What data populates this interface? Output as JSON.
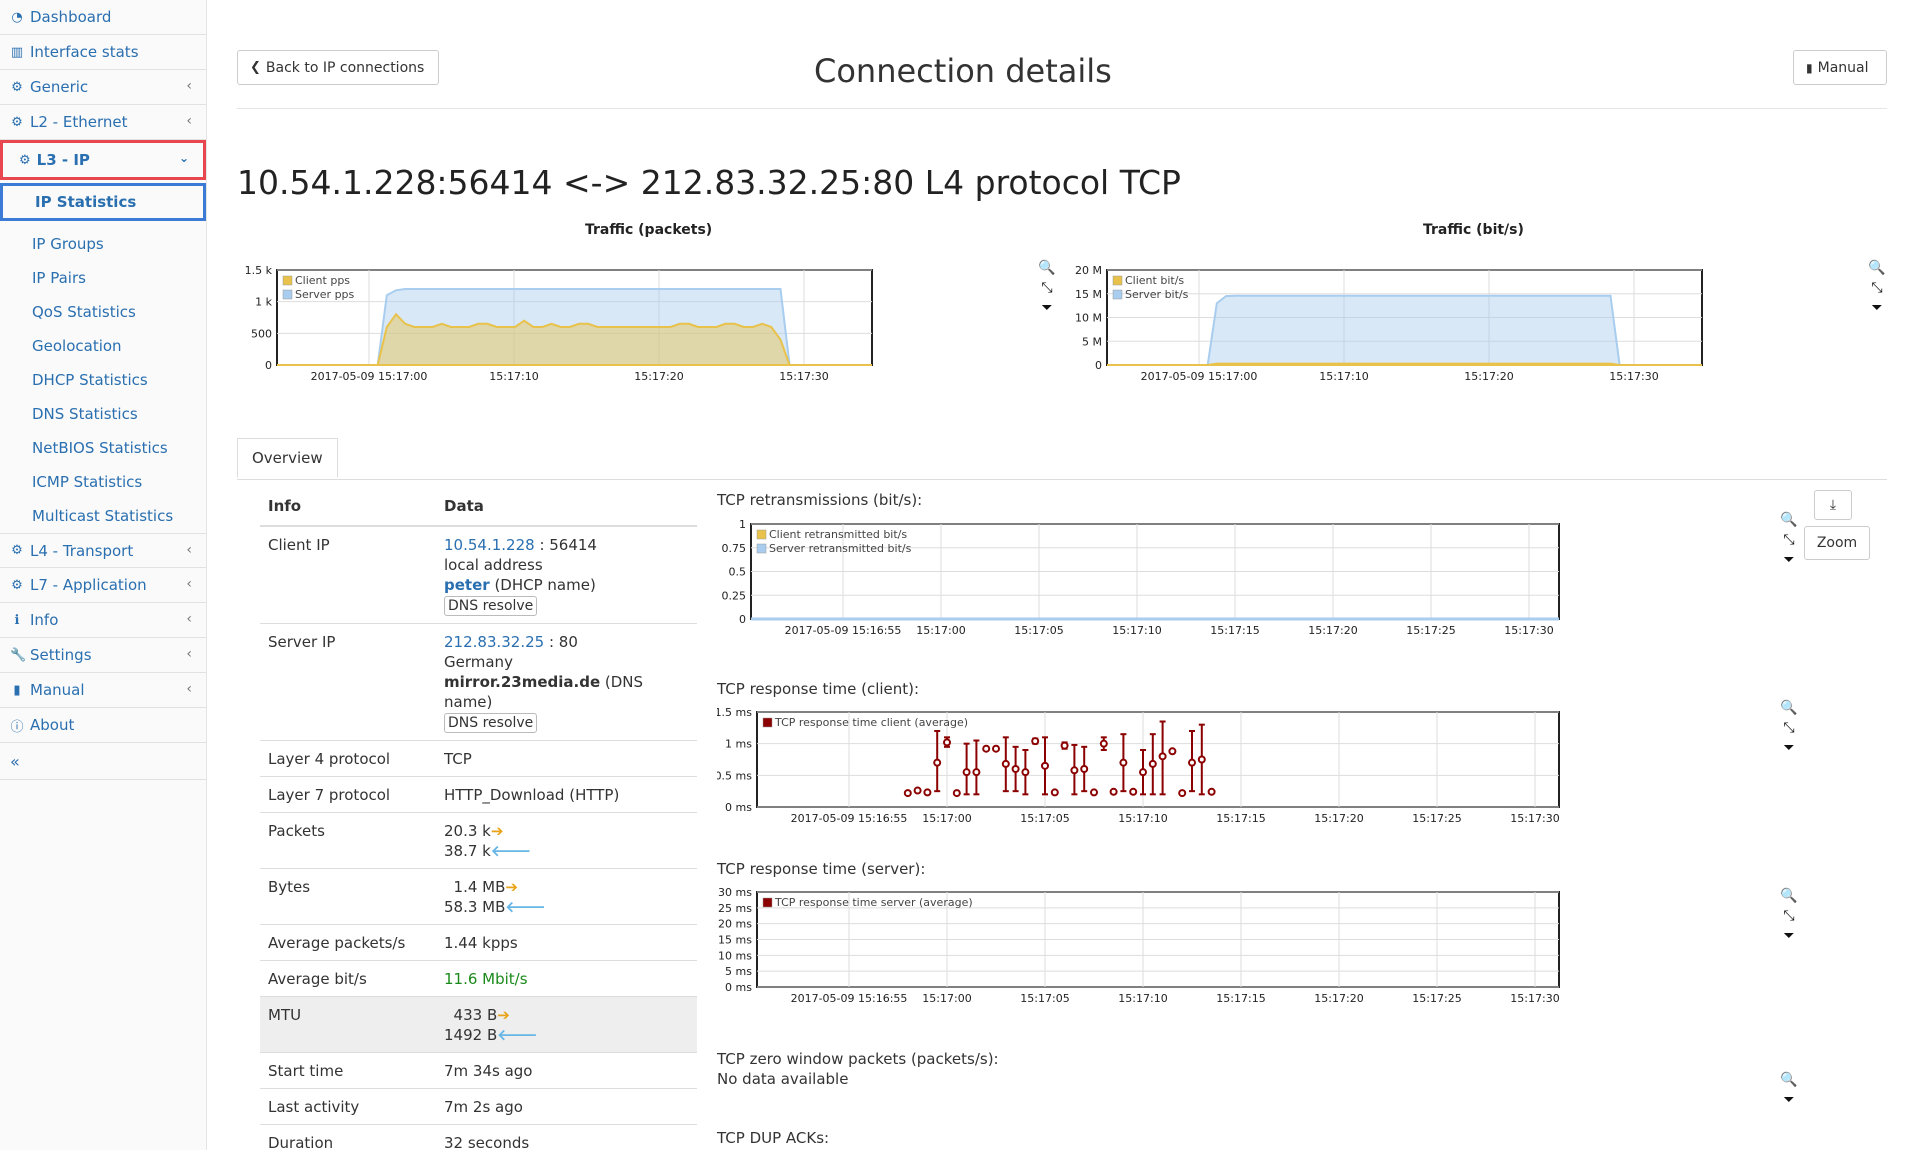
{
  "sidebar": {
    "top_items": [
      {
        "icon": "dashboard-icon",
        "glyph": "◔",
        "label": "Dashboard"
      },
      {
        "icon": "bar-chart-icon",
        "glyph": "▥",
        "label": "Interface stats"
      },
      {
        "icon": "gear-icon",
        "glyph": "⚙",
        "label": "Generic"
      },
      {
        "icon": "gear-icon",
        "glyph": "⚙",
        "label": "L2 - Ethernet"
      }
    ],
    "active_section": "L3 - IP",
    "active_sub": "IP Statistics",
    "sub_items": [
      "IP Groups",
      "IP Pairs",
      "QoS Statistics",
      "Geolocation",
      "DHCP Statistics",
      "DNS Statistics",
      "NetBIOS Statistics",
      "ICMP Statistics",
      "Multicast Statistics"
    ],
    "bottom_items": [
      {
        "icon": "gear-icon",
        "glyph": "⚙",
        "label": "L4 - Transport",
        "chevron": true
      },
      {
        "icon": "gear-icon",
        "glyph": "⚙",
        "label": "L7 - Application",
        "chevron": true
      },
      {
        "icon": "info-icon",
        "glyph": "ℹ",
        "label": "Info",
        "chevron": true
      },
      {
        "icon": "wrench-icon",
        "glyph": "🔧",
        "label": "Settings",
        "chevron": true
      },
      {
        "icon": "book-icon",
        "glyph": "▮",
        "label": "Manual",
        "chevron": true
      },
      {
        "icon": "info-circle-icon",
        "glyph": "ⓘ",
        "label": "About",
        "chevron": false
      }
    ],
    "collapse_glyph": "«"
  },
  "header": {
    "back_button": "Back to IP connections",
    "title": "Connection details",
    "manual_button": "Manual"
  },
  "connection_title": "10.54.1.228:56414 <-> 212.83.32.25:80 L4 protocol TCP",
  "tabs": [
    "Overview"
  ],
  "table": {
    "headers": [
      "Info",
      "Data"
    ],
    "client_ip": {
      "label": "Client IP",
      "ip": "10.54.1.228",
      "port": ": 56414",
      "local": "local address",
      "dhcp_name": "peter",
      "dhcp_suffix": "(DHCP name)",
      "dns_btn": "DNS resolve"
    },
    "server_ip": {
      "label": "Server IP",
      "ip": "212.83.32.25",
      "port": ": 80",
      "country": "Germany",
      "dns_name": "mirror.23media.de",
      "dns_suffix": "(DNS name)",
      "dns_btn": "DNS resolve"
    },
    "l4": {
      "label": "Layer 4 protocol",
      "value": "TCP"
    },
    "l7": {
      "label": "Layer 7 protocol",
      "value": "HTTP_Download (HTTP)"
    },
    "packets": {
      "label": "Packets",
      "v1": "20.3 k",
      "v2": "38.7 k"
    },
    "bytes": {
      "label": "Bytes",
      "v1": "1.4 MB",
      "v2": "58.3 MB"
    },
    "avg_pps": {
      "label": "Average packets/s",
      "value": "1.44 kpps"
    },
    "avg_bps": {
      "label": "Average bit/s",
      "value": "11.6 Mbit/s"
    },
    "mtu": {
      "label": "MTU",
      "v1": "433 B",
      "v2": "1492 B"
    },
    "start": {
      "label": "Start time",
      "value": "7m 34s ago"
    },
    "last": {
      "label": "Last activity",
      "value": "7m 2s ago"
    },
    "duration": {
      "label": "Duration",
      "value": "32 seconds"
    }
  },
  "graphs": {
    "retrans_title": "TCP retransmissions (bit/s):",
    "resp_client_title": "TCP response time (client):",
    "resp_server_title": "TCP response time (server):",
    "zero_window_title": "TCP zero window packets (packets/s):",
    "zero_window_text": "No data available",
    "dup_acks_title": "TCP DUP ACKs:",
    "zoom_button": "Zoom",
    "download_icon": "download-icon"
  },
  "chart_data": [
    {
      "type": "area",
      "title": "Traffic (packets)",
      "series": [
        {
          "name": "Client pps",
          "color": "#e8c24a",
          "values": [
            0,
            0,
            0,
            0,
            0,
            0,
            0,
            0,
            0,
            0,
            0,
            0,
            600,
            800,
            650,
            600,
            600,
            600,
            650,
            600,
            600,
            600,
            650,
            650,
            600,
            600,
            600,
            700,
            600,
            600,
            650,
            600,
            600,
            650,
            650,
            600,
            600,
            600,
            600,
            600,
            600,
            600,
            600,
            600,
            650,
            650,
            600,
            600,
            600,
            650,
            650,
            600,
            600,
            650,
            600,
            400,
            0,
            0,
            0,
            0,
            0,
            0,
            0,
            0,
            0,
            0
          ]
        },
        {
          "name": "Server pps",
          "color": "#a8cdee",
          "values": [
            0,
            0,
            0,
            0,
            0,
            0,
            0,
            0,
            0,
            0,
            0,
            0,
            1100,
            1180,
            1200,
            1200,
            1200,
            1200,
            1200,
            1200,
            1200,
            1200,
            1200,
            1200,
            1200,
            1200,
            1200,
            1200,
            1200,
            1200,
            1200,
            1200,
            1200,
            1200,
            1200,
            1200,
            1200,
            1200,
            1200,
            1200,
            1200,
            1200,
            1200,
            1200,
            1200,
            1200,
            1200,
            1200,
            1200,
            1200,
            1200,
            1200,
            1200,
            1200,
            1200,
            1200,
            0,
            0,
            0,
            0,
            0,
            0,
            0,
            0,
            0,
            0
          ]
        }
      ],
      "yticks": [
        "1.5 k",
        "1 k",
        "500",
        "0"
      ],
      "ymax": 1500,
      "xticks": [
        "2017-05-09 15:17:00",
        "15:17:10",
        "15:17:20",
        "15:17:30"
      ]
    },
    {
      "type": "area",
      "title": "Traffic (bit/s)",
      "series": [
        {
          "name": "Client bit/s",
          "color": "#e8c24a",
          "values": [
            0,
            0,
            0,
            0,
            0,
            0,
            0,
            0,
            0,
            0,
            0,
            0,
            300000,
            300000,
            300000,
            300000,
            300000,
            300000,
            300000,
            300000,
            300000,
            300000,
            300000,
            300000,
            300000,
            300000,
            300000,
            300000,
            300000,
            300000,
            300000,
            300000,
            300000,
            300000,
            300000,
            300000,
            300000,
            300000,
            300000,
            300000,
            300000,
            300000,
            300000,
            300000,
            300000,
            300000,
            300000,
            300000,
            300000,
            300000,
            300000,
            300000,
            300000,
            300000,
            300000,
            300000,
            0,
            0,
            0,
            0,
            0,
            0,
            0,
            0,
            0,
            0
          ]
        },
        {
          "name": "Server bit/s",
          "color": "#a8cdee",
          "values": [
            0,
            0,
            0,
            0,
            0,
            0,
            0,
            0,
            0,
            0,
            0,
            0,
            13000000,
            14500000,
            14600000,
            14600000,
            14600000,
            14600000,
            14600000,
            14600000,
            14600000,
            14600000,
            14600000,
            14600000,
            14600000,
            14600000,
            14600000,
            14600000,
            14600000,
            14600000,
            14600000,
            14600000,
            14600000,
            14600000,
            14600000,
            14600000,
            14600000,
            14600000,
            14600000,
            14600000,
            14600000,
            14600000,
            14600000,
            14600000,
            14600000,
            14600000,
            14600000,
            14600000,
            14600000,
            14600000,
            14600000,
            14600000,
            14600000,
            14600000,
            14600000,
            14600000,
            0,
            0,
            0,
            0,
            0,
            0,
            0,
            0,
            0,
            0
          ]
        }
      ],
      "yticks": [
        "20 M",
        "15 M",
        "10 M",
        "5 M",
        "0"
      ],
      "ymax": 20000000,
      "xticks": [
        "2017-05-09 15:17:00",
        "15:17:10",
        "15:17:20",
        "15:17:30"
      ]
    },
    {
      "type": "line",
      "title": "TCP retransmissions (bit/s):",
      "series": [
        {
          "name": "Client retransmitted bit/s",
          "color": "#e8c24a"
        },
        {
          "name": "Server retransmitted bit/s",
          "color": "#a8cdee"
        }
      ],
      "yticks": [
        "1",
        "0.75",
        "0.5",
        "0.25",
        "0"
      ],
      "xticks": [
        "2017-05-09 15:16:55",
        "15:17:00",
        "15:17:05",
        "15:17:10",
        "15:17:15",
        "15:17:20",
        "15:17:25",
        "15:17:30"
      ]
    },
    {
      "type": "scatter",
      "title": "TCP response time (client):",
      "series": [
        {
          "name": "TCP response time client (average)",
          "color": "#8b0000"
        }
      ],
      "yticks": [
        "1.5 ms",
        "1 ms",
        "0.5 ms",
        "0 ms"
      ],
      "ymax": 1.5,
      "xticks": [
        "2017-05-09 15:16:55",
        "15:17:00",
        "15:17:05",
        "15:17:10",
        "15:17:15",
        "15:17:20",
        "15:17:25",
        "15:17:30"
      ],
      "points": [
        {
          "t": -2,
          "v": 0.22
        },
        {
          "t": -1.5,
          "v": 0.26
        },
        {
          "t": -1,
          "v": 0.23
        },
        {
          "t": -0.5,
          "v": 0.7,
          "lo": 0.25,
          "hi": 1.2
        },
        {
          "t": 0,
          "v": 1.02,
          "lo": 0.95,
          "hi": 1.1
        },
        {
          "t": 0.5,
          "v": 0.22
        },
        {
          "t": 1,
          "v": 0.55,
          "lo": 0.2,
          "hi": 1.0
        },
        {
          "t": 1.5,
          "v": 0.55,
          "lo": 0.2,
          "hi": 1.05
        },
        {
          "t": 2,
          "v": 0.92
        },
        {
          "t": 2.5,
          "v": 0.92
        },
        {
          "t": 3,
          "v": 0.68,
          "lo": 0.25,
          "hi": 1.1
        },
        {
          "t": 3.5,
          "v": 0.6,
          "lo": 0.25,
          "hi": 0.95
        },
        {
          "t": 4,
          "v": 0.55,
          "lo": 0.2,
          "hi": 0.9
        },
        {
          "t": 4.5,
          "v": 1.04,
          "lo": 1.0,
          "hi": 1.08
        },
        {
          "t": 5,
          "v": 0.65,
          "lo": 0.2,
          "hi": 1.1
        },
        {
          "t": 5.5,
          "v": 0.23
        },
        {
          "t": 6,
          "v": 0.97,
          "lo": 0.92,
          "hi": 1.02
        },
        {
          "t": 6.5,
          "v": 0.58,
          "lo": 0.2,
          "hi": 0.98
        },
        {
          "t": 7,
          "v": 0.6,
          "lo": 0.25,
          "hi": 0.95
        },
        {
          "t": 7.5,
          "v": 0.23
        },
        {
          "t": 8,
          "v": 1.0,
          "lo": 0.9,
          "hi": 1.1
        },
        {
          "t": 8.5,
          "v": 0.24
        },
        {
          "t": 9,
          "v": 0.7,
          "lo": 0.25,
          "hi": 1.15
        },
        {
          "t": 9.5,
          "v": 0.24
        },
        {
          "t": 10,
          "v": 0.55,
          "lo": 0.2,
          "hi": 0.9
        },
        {
          "t": 10.5,
          "v": 0.68,
          "lo": 0.2,
          "hi": 1.15
        },
        {
          "t": 11,
          "v": 0.8,
          "lo": 0.2,
          "hi": 1.35
        },
        {
          "t": 11.5,
          "v": 0.88
        },
        {
          "t": 12,
          "v": 0.22
        },
        {
          "t": 12.5,
          "v": 0.7,
          "lo": 0.25,
          "hi": 1.2
        },
        {
          "t": 13,
          "v": 0.75,
          "lo": 0.2,
          "hi": 1.3
        },
        {
          "t": 13.5,
          "v": 0.24
        }
      ]
    },
    {
      "type": "scatter",
      "title": "TCP response time (server):",
      "series": [
        {
          "name": "TCP response time server (average)",
          "color": "#8b0000"
        }
      ],
      "yticks": [
        "30 ms",
        "25 ms",
        "20 ms",
        "15 ms",
        "10 ms",
        "5 ms",
        "0 ms"
      ],
      "xticks": [
        "2017-05-09 15:16:55",
        "15:17:00",
        "15:17:05",
        "15:17:10",
        "15:17:15",
        "15:17:20",
        "15:17:25",
        "15:17:30"
      ]
    }
  ]
}
